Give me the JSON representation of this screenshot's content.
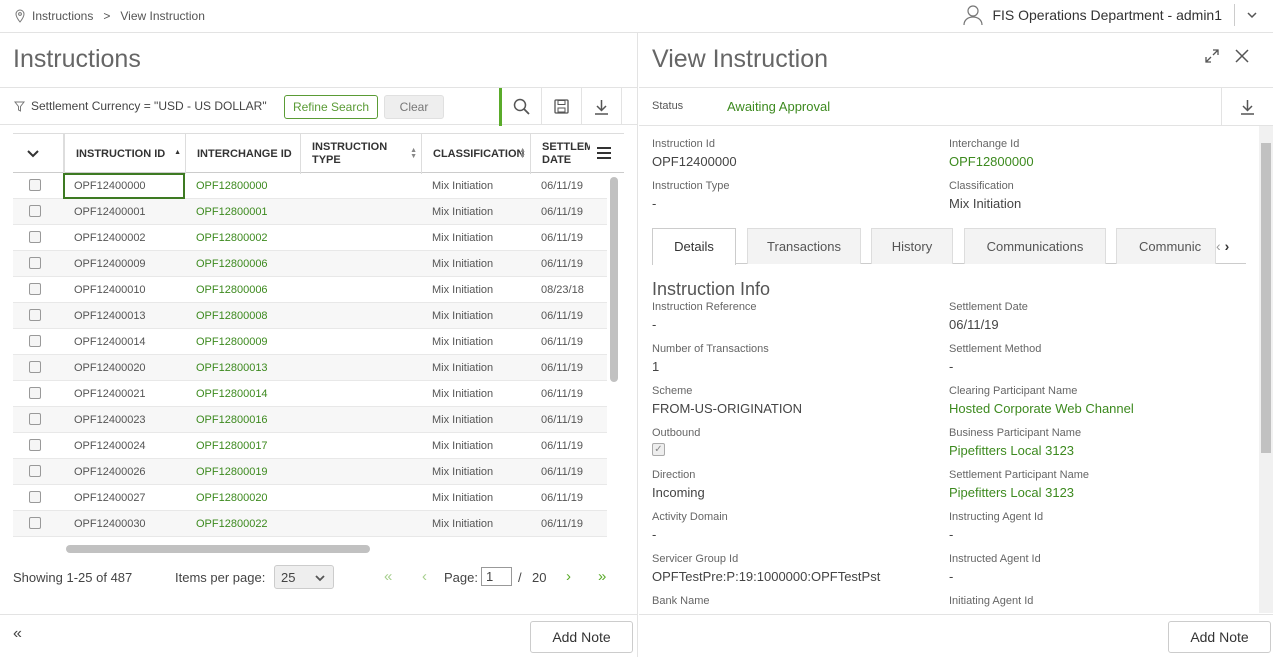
{
  "breadcrumb": {
    "root": "Instructions",
    "separator": ">",
    "current": "View Instruction"
  },
  "user": {
    "name": "FIS Operations Department - admin1"
  },
  "left": {
    "title": "Instructions",
    "filter_text": "Settlement Currency = \"USD - US DOLLAR\"",
    "refine_label": "Refine Search",
    "clear_label": "Clear",
    "columns": [
      "INSTRUCTION ID",
      "INTERCHANGE ID",
      "INSTRUCTION TYPE",
      "CLASSIFICATION",
      "SETTLEMENT DATE"
    ],
    "col_instruction_type_l1": "INSTRUCTION",
    "col_instruction_type_l2": "TYPE",
    "col_settlement_l1": "SETTLEM",
    "col_settlement_l2": "DATE",
    "rows": [
      {
        "id": "OPF12400000",
        "interchange": "OPF12800000",
        "type": "",
        "classification": "Mix Initiation",
        "date": "06/11/19"
      },
      {
        "id": "OPF12400001",
        "interchange": "OPF12800001",
        "type": "",
        "classification": "Mix Initiation",
        "date": "06/11/19"
      },
      {
        "id": "OPF12400002",
        "interchange": "OPF12800002",
        "type": "",
        "classification": "Mix Initiation",
        "date": "06/11/19"
      },
      {
        "id": "OPF12400009",
        "interchange": "OPF12800006",
        "type": "",
        "classification": "Mix Initiation",
        "date": "06/11/19"
      },
      {
        "id": "OPF12400010",
        "interchange": "OPF12800006",
        "type": "",
        "classification": "Mix Initiation",
        "date": "08/23/18"
      },
      {
        "id": "OPF12400013",
        "interchange": "OPF12800008",
        "type": "",
        "classification": "Mix Initiation",
        "date": "06/11/19"
      },
      {
        "id": "OPF12400014",
        "interchange": "OPF12800009",
        "type": "",
        "classification": "Mix Initiation",
        "date": "06/11/19"
      },
      {
        "id": "OPF12400020",
        "interchange": "OPF12800013",
        "type": "",
        "classification": "Mix Initiation",
        "date": "06/11/19"
      },
      {
        "id": "OPF12400021",
        "interchange": "OPF12800014",
        "type": "",
        "classification": "Mix Initiation",
        "date": "06/11/19"
      },
      {
        "id": "OPF12400023",
        "interchange": "OPF12800016",
        "type": "",
        "classification": "Mix Initiation",
        "date": "06/11/19"
      },
      {
        "id": "OPF12400024",
        "interchange": "OPF12800017",
        "type": "",
        "classification": "Mix Initiation",
        "date": "06/11/19"
      },
      {
        "id": "OPF12400026",
        "interchange": "OPF12800019",
        "type": "",
        "classification": "Mix Initiation",
        "date": "06/11/19"
      },
      {
        "id": "OPF12400027",
        "interchange": "OPF12800020",
        "type": "",
        "classification": "Mix Initiation",
        "date": "06/11/19"
      },
      {
        "id": "OPF12400030",
        "interchange": "OPF12800022",
        "type": "",
        "classification": "Mix Initiation",
        "date": "06/11/19"
      }
    ],
    "pager": {
      "showing": "Showing 1-25 of 487",
      "items_per_page_label": "Items per page:",
      "items_per_page": "25",
      "page_label": "Page:",
      "page": "1",
      "slash": "/",
      "total_pages": "20"
    },
    "add_note_label": "Add Note"
  },
  "right": {
    "title": "View Instruction",
    "status_label": "Status",
    "status_value": "Awaiting Approval",
    "header_fields": {
      "instruction_id_label": "Instruction Id",
      "instruction_id": "OPF12400000",
      "interchange_id_label": "Interchange Id",
      "interchange_id": "OPF12800000",
      "instruction_type_label": "Instruction Type",
      "instruction_type": "-",
      "classification_label": "Classification",
      "classification": "Mix Initiation"
    },
    "tabs": [
      "Details",
      "Transactions",
      "History",
      "Communications",
      "Communic"
    ],
    "section_title": "Instruction Info",
    "fields": {
      "instruction_reference_label": "Instruction Reference",
      "instruction_reference": "-",
      "settlement_date_label": "Settlement Date",
      "settlement_date": "06/11/19",
      "num_transactions_label": "Number of Transactions",
      "num_transactions": "1",
      "settlement_method_label": "Settlement Method",
      "settlement_method": "-",
      "scheme_label": "Scheme",
      "scheme": "FROM-US-ORIGINATION",
      "clearing_participant_label": "Clearing Participant Name",
      "clearing_participant": "Hosted Corporate Web Channel",
      "outbound_label": "Outbound",
      "business_participant_label": "Business Participant Name",
      "business_participant": "Pipefitters Local 3123",
      "direction_label": "Direction",
      "direction": "Incoming",
      "settlement_participant_label": "Settlement Participant Name",
      "settlement_participant": "Pipefitters Local 3123",
      "activity_domain_label": "Activity Domain",
      "activity_domain": "-",
      "instructing_agent_label": "Instructing Agent Id",
      "instructing_agent": "-",
      "servicer_group_label": "Servicer Group Id",
      "servicer_group": "OPFTestPre:P:19:1000000:OPFTestPst",
      "instructed_agent_label": "Instructed Agent Id",
      "instructed_agent": "-",
      "bank_name_label": "Bank Name",
      "initiating_agent_label": "Initiating Agent Id"
    },
    "add_note_label": "Add Note"
  },
  "colors": {
    "accent": "#5aab2a",
    "link": "#3d8a1f"
  }
}
